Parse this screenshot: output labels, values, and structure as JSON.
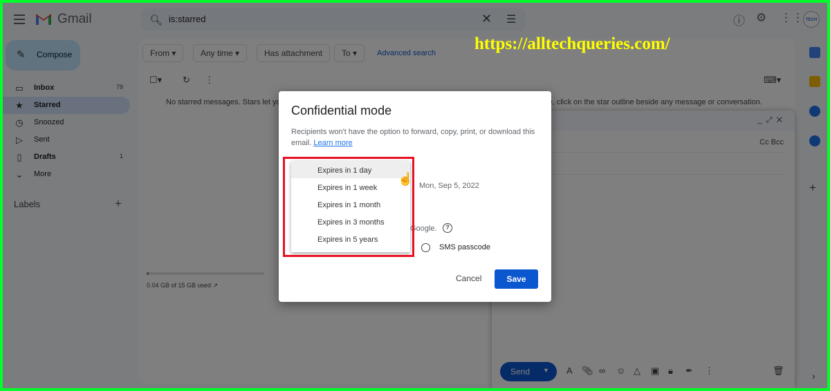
{
  "app": {
    "brand": "Gmail"
  },
  "search": {
    "query": "is:starred"
  },
  "header_icons": [
    "help-icon",
    "settings-icon",
    "apps-icon"
  ],
  "avatar_text": "TECH",
  "sidebar": {
    "compose_label": "Compose",
    "items": [
      {
        "label": "Inbox",
        "count": "79",
        "icon": "▭",
        "bold": true
      },
      {
        "label": "Starred",
        "count": "",
        "icon": "★",
        "selected": true,
        "bold": true
      },
      {
        "label": "Snoozed",
        "count": "",
        "icon": "◷"
      },
      {
        "label": "Sent",
        "count": "",
        "icon": "▷"
      },
      {
        "label": "Drafts",
        "count": "1",
        "icon": "▯",
        "bold": true
      },
      {
        "label": "More",
        "count": "",
        "icon": "⌄"
      }
    ],
    "labels_heading": "Labels"
  },
  "filters": {
    "from": "From",
    "any_time": "Any time",
    "has_attachment": "Has attachment",
    "to": "To",
    "advanced": "Advanced search"
  },
  "empty_message": "No starred messages. Stars let you give messages a special status to make them easier to find. To star a message, click on the star outline beside any message or conversation.",
  "storage": {
    "text": "0.04 GB of 15 GB used",
    "used_fraction": 0.003
  },
  "compose_window": {
    "cc_bcc": "Cc Bcc",
    "send": "Send"
  },
  "dialog": {
    "title": "Confidential mode",
    "description": "Recipients won't have the option to forward, copy, print, or download this email.",
    "learn_more": "Learn more",
    "expiry_date": "Mon, Sep 5, 2022",
    "google_text": "Google.",
    "sms_label": "SMS passcode",
    "cancel": "Cancel",
    "save": "Save",
    "expiry_options": [
      "Expires in 1 day",
      "Expires in 1 week",
      "Expires in 1 month",
      "Expires in 3 months",
      "Expires in 5 years"
    ],
    "hovered_option": "Expires in 1 day"
  },
  "watermark": "https://alltechqueries.com/",
  "colors": {
    "accent": "#0b57d0",
    "highlight": "#e81123",
    "watermark": "#ffff00"
  }
}
